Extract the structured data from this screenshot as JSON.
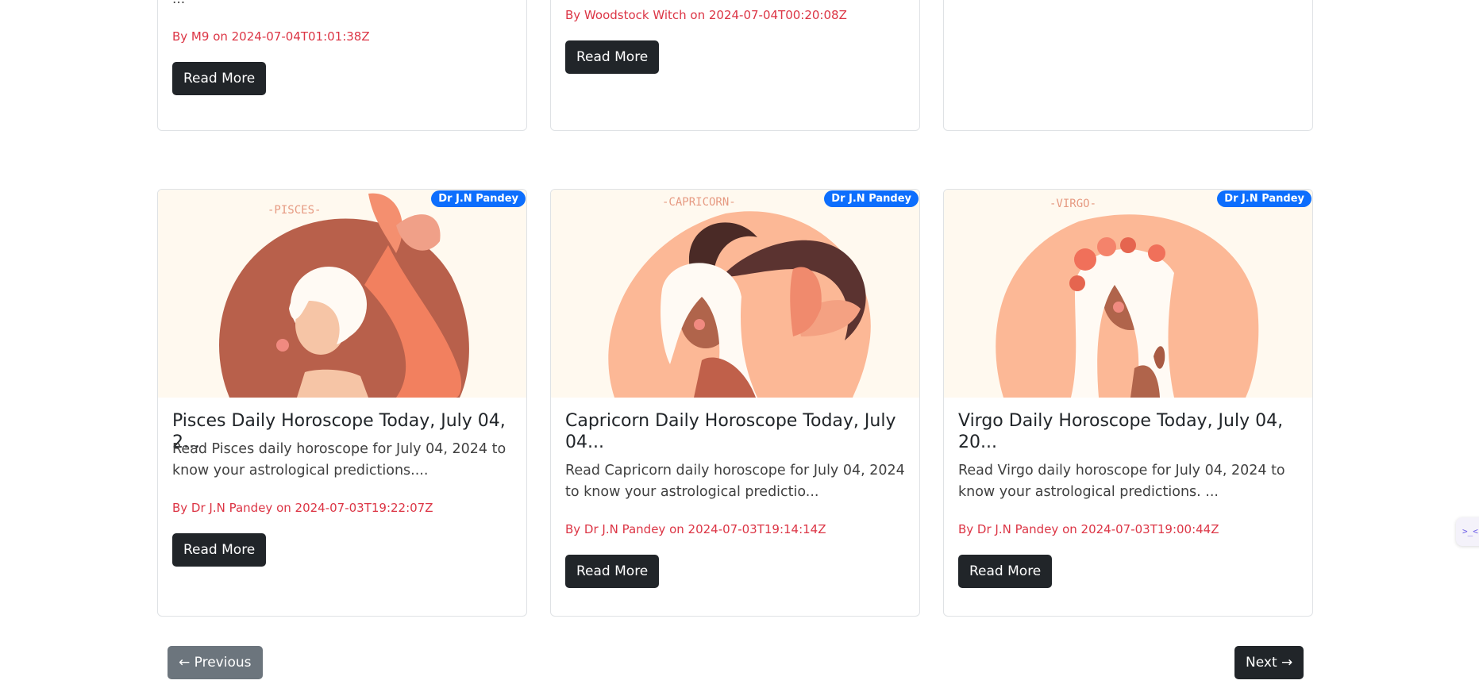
{
  "top_cards": [
    {
      "ellipsis": "...",
      "meta": "By M9 on 2024-07-04T01:01:38Z",
      "button": "Read More"
    },
    {
      "meta": "By Woodstock Witch on 2024-07-04T00:20:08Z",
      "button": "Read More"
    },
    {}
  ],
  "cards": [
    {
      "badge": "Dr J.N Pandey",
      "image_label": "-PISCES-",
      "title": "Pisces Daily Horoscope Today, July 04, 2...",
      "description": "Read Pisces daily horoscope for July 04, 2024 to know your astrological predictions....",
      "meta": "By Dr J.N Pandey on 2024-07-03T19:22:07Z",
      "button": "Read More"
    },
    {
      "badge": "Dr J.N Pandey",
      "image_label": "-CAPRICORN-",
      "title": "Capricorn Daily Horoscope Today, July 04...",
      "description": "Read Capricorn daily horoscope for July 04, 2024 to know your astrological predictio...",
      "meta": "By Dr J.N Pandey on 2024-07-03T19:14:14Z",
      "button": "Read More"
    },
    {
      "badge": "Dr J.N Pandey",
      "image_label": "-VIRGO-",
      "title": "Virgo Daily Horoscope Today, July 04, 20...",
      "description": "Read Virgo daily horoscope for July 04, 2024 to know your astrological predictions. ...",
      "meta": "By Dr J.N Pandey on 2024-07-03T19:00:44Z",
      "button": "Read More"
    }
  ],
  "pagination": {
    "previous": "← Previous",
    "next": "Next →"
  },
  "side_widget": {
    "label": ">_<"
  },
  "colors": {
    "meta": "#dc3545",
    "badge": "#0d6efd",
    "button_dark": "#212529",
    "button_secondary": "#6c757d"
  }
}
